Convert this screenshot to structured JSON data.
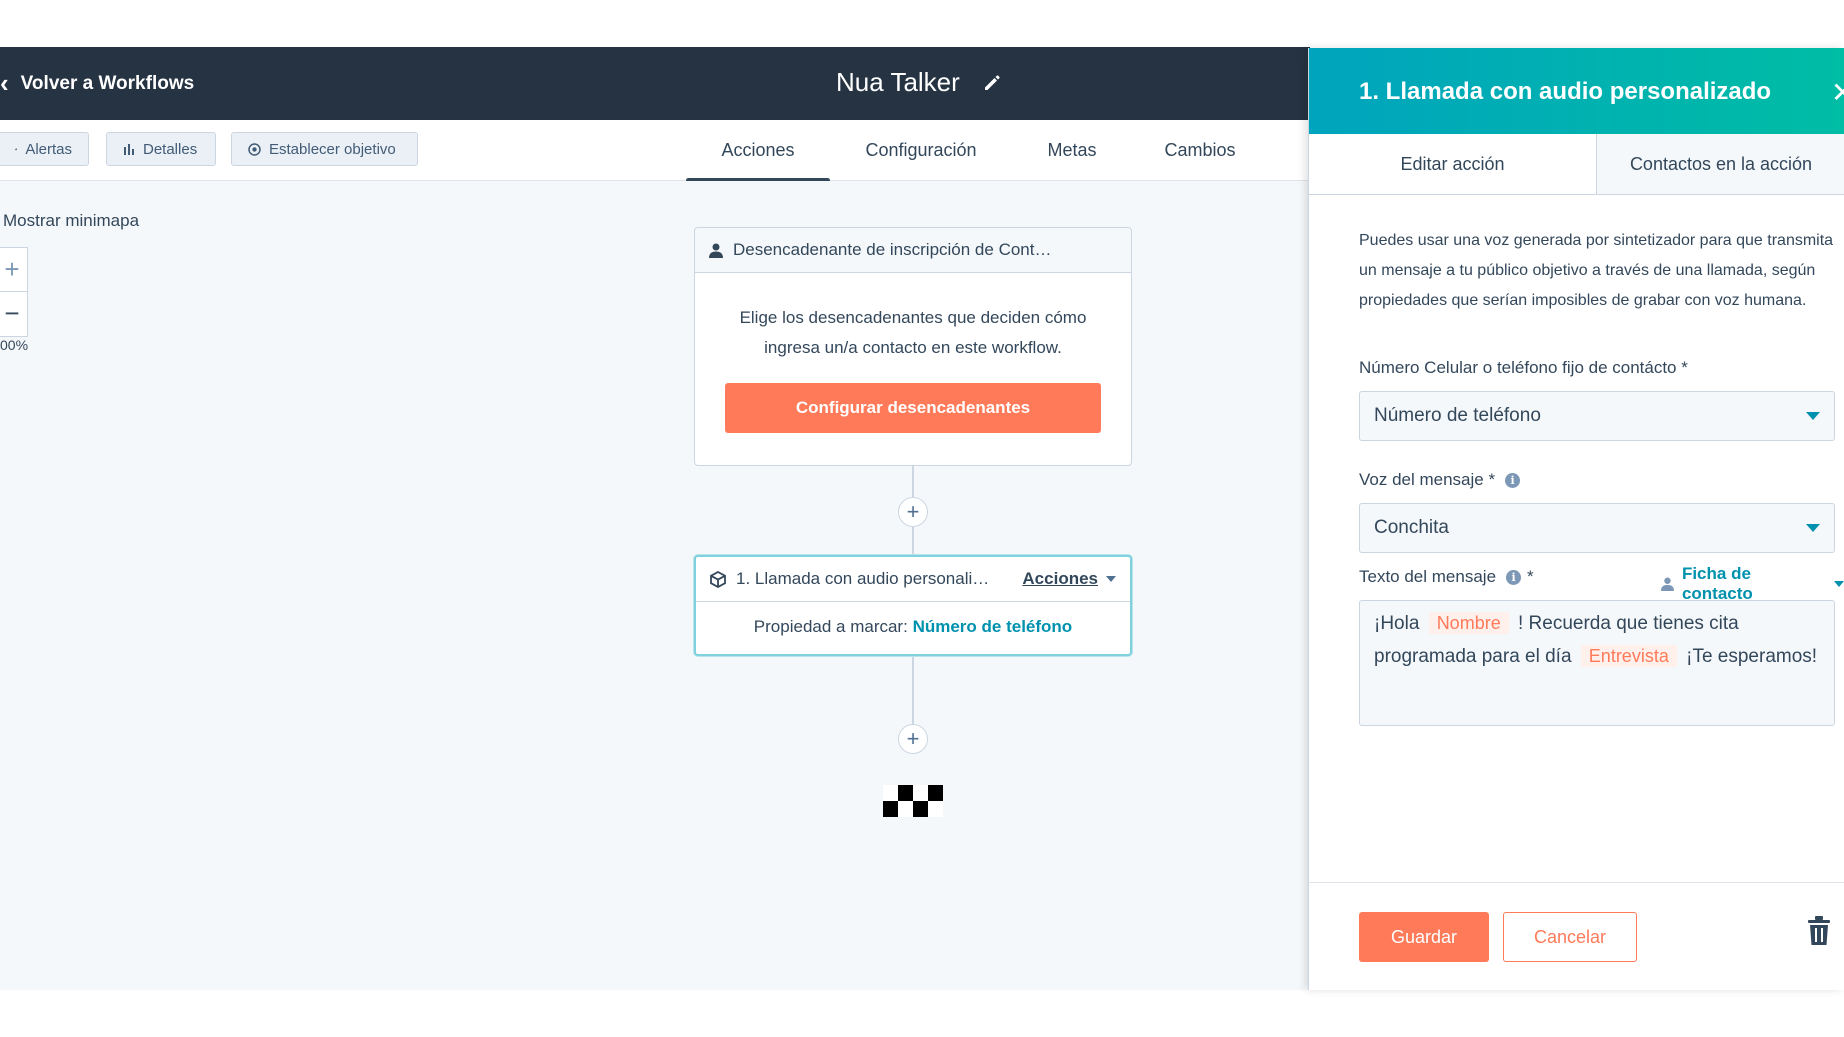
{
  "header": {
    "back_label": "Volver a Workflows",
    "workflow_name": "Nua Talker"
  },
  "toolbar": {
    "alerts_label": "Alertas",
    "details_label": "Detalles",
    "goal_label": "Establecer objetivo",
    "tabs": [
      {
        "label": "Acciones",
        "active": true
      },
      {
        "label": "Configuración",
        "active": false
      },
      {
        "label": "Metas",
        "active": false
      },
      {
        "label": "Cambios",
        "active": false
      }
    ]
  },
  "canvas": {
    "minimap_label": "Mostrar minimapa",
    "zoom_percent": "00%",
    "trigger_card": {
      "title": "Desencadenante de inscripción de Cont…",
      "body": "Elige los desencadenantes que deciden cómo ingresa un/a contacto en este workflow.",
      "button_label": "Configurar desencadenantes"
    },
    "action_card": {
      "title": "1. Llamada con audio personali…",
      "actions_label": "Acciones",
      "property_label": "Propiedad a marcar:",
      "property_value": "Número de teléfono"
    }
  },
  "panel": {
    "title": "1. Llamada con audio personalizado",
    "tabs": [
      {
        "label": "Editar acción",
        "active": true
      },
      {
        "label": "Contactos en la acción",
        "active": false
      }
    ],
    "description": "Puedes usar una voz generada por sintetizador para que transmita un mensaje a tu público objetivo a través de una llamada, según propiedades que serían imposibles de grabar con voz humana.",
    "phone_field": {
      "label": "Número Celular o teléfono fijo de contácto *",
      "value": "Número de teléfono"
    },
    "voice_field": {
      "label": "Voz del mensaje *",
      "value": "Conchita"
    },
    "message_field": {
      "label": "Texto del mensaje",
      "required_mark": "*",
      "contact_token_label": "Ficha de contacto",
      "text_part1": "¡Hola",
      "token1": "Nombre",
      "text_part2": "! Recuerda que tienes cita programada para el día",
      "token2": "Entrevista",
      "text_part3": "¡Te esperamos!"
    },
    "save_label": "Guardar",
    "cancel_label": "Cancelar"
  },
  "colors": {
    "header_bg": "#253342",
    "accent_orange": "#ff7a59",
    "panel_gradient_start": "#00a4bd",
    "panel_gradient_end": "#00bda5",
    "link_teal": "#0091ae",
    "canvas_bg": "#f5f8fa"
  },
  "icons": [
    "chevron-left-icon",
    "pencil-icon",
    "warning-icon",
    "bar-chart-icon",
    "target-icon",
    "person-icon",
    "cube-icon",
    "plus-icon",
    "checkered-flag-icon",
    "close-icon",
    "info-icon",
    "trash-icon"
  ]
}
